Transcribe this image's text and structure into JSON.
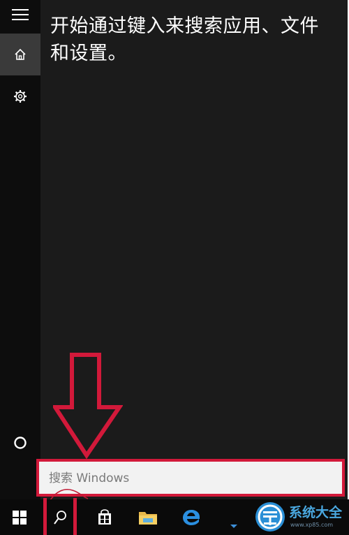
{
  "start_menu": {
    "hint_text": "开始通过键入来搜索应用、文件和设置。",
    "rail": {
      "menu_icon": "hamburger-icon",
      "home_icon": "home-icon",
      "settings_icon": "gear-icon",
      "cortana_icon": "cortana-circle-icon"
    }
  },
  "search": {
    "placeholder": "搜索 Windows"
  },
  "taskbar": {
    "items": [
      "windows-logo-icon",
      "search-icon",
      "store-icon",
      "file-explorer-icon",
      "edge-icon"
    ]
  },
  "watermark": {
    "title": "系统大全",
    "subtitle": "www.xp85.com"
  },
  "colors": {
    "highlight": "#d2193a",
    "start_bg": "#1b1b1b",
    "rail_bg": "#0d0d0d",
    "taskbar_bg": "#0a0a0a",
    "edge_blue": "#1e88e5"
  }
}
